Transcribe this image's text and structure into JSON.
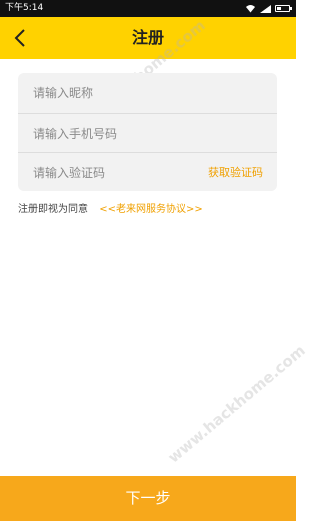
{
  "status_bar": {
    "time": "下午5:14"
  },
  "header": {
    "title": "注册",
    "back_icon": "chevron-left-icon",
    "background": "#ffd200"
  },
  "form": {
    "nickname": {
      "placeholder": "请输入昵称",
      "value": ""
    },
    "phone": {
      "placeholder": "请输入手机号码",
      "value": ""
    },
    "code": {
      "placeholder": "请输入验证码",
      "value": ""
    },
    "get_code_label": "获取验证码"
  },
  "agreement": {
    "text": "注册即视为同意",
    "link": "<<老来网服务协议>>"
  },
  "next_button": {
    "label": "下一步",
    "color": "#f7a81b"
  },
  "watermarks": [
    "www.hackhome.com",
    "www.hackhome.com"
  ]
}
